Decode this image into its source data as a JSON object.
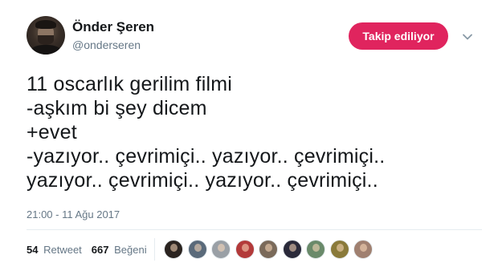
{
  "tweet": {
    "author": {
      "display_name": "Önder Şeren",
      "handle": "@onderseren"
    },
    "follow_button_label": "Takip ediliyor",
    "text_lines": [
      "11 oscarlık gerilim filmi",
      "-aşkım bi şey dicem",
      "+evet",
      "-yazıyor.. çevrimiçi.. yazıyor.. çevrimiçi..",
      "yazıyor.. çevrimiçi.. yazıyor.. çevrimiçi.."
    ],
    "timestamp": "21:00 - 11 Ağu 2017",
    "stats": {
      "retweets_count": "54",
      "retweets_label": "Retweet",
      "likes_count": "667",
      "likes_label": "Beğeni"
    },
    "liker_avatar_colors": [
      "#2b2420",
      "#5a6a7a",
      "#9aa0a6",
      "#b33a3a",
      "#7a6a5a",
      "#2a2a3a",
      "#6a8a6a",
      "#8a7a3a",
      "#a08070"
    ]
  },
  "icons": {
    "menu": "chevron-down-icon"
  },
  "colors": {
    "accent": "#e0245e",
    "text": "#14171a",
    "muted": "#657786",
    "divider": "#e6ecf0"
  }
}
